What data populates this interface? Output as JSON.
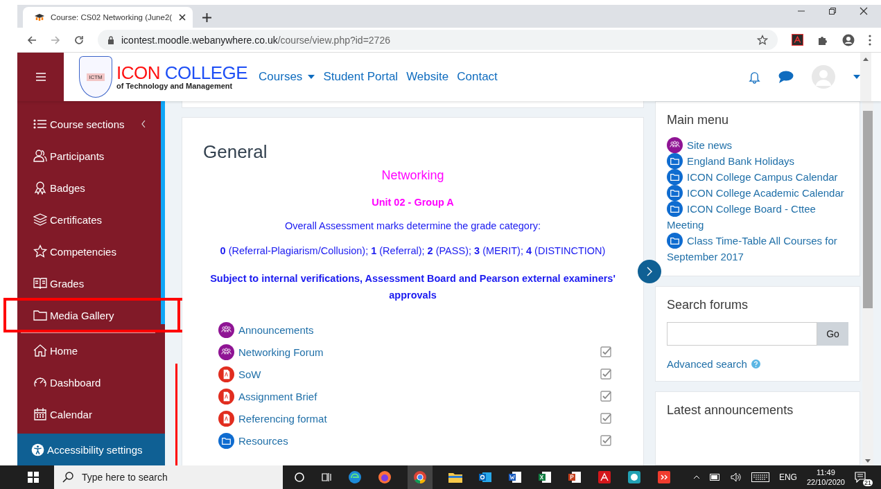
{
  "browser": {
    "tab_title": "Course: CS02 Networking (June2(",
    "url_host": "icontest.moodle.webanywhere.co.uk",
    "url_path": "/course/view.php?id=2726"
  },
  "header": {
    "brand_main": "ICON",
    "brand_second": "COLLEGE",
    "brand_sub": "of Technology and Management",
    "logo_caption": "ICTM",
    "nav": [
      {
        "label": "Courses",
        "dropdown": true
      },
      {
        "label": "Student Portal",
        "dropdown": false
      },
      {
        "label": "Website",
        "dropdown": false
      },
      {
        "label": "Contact",
        "dropdown": false
      }
    ]
  },
  "sidebar": {
    "items": [
      {
        "label": "Course sections",
        "collapsible": true
      },
      {
        "label": "Participants",
        "collapsible": false
      },
      {
        "label": "Badges",
        "collapsible": false
      },
      {
        "label": "Certificates",
        "collapsible": false
      },
      {
        "label": "Competencies",
        "collapsible": false
      },
      {
        "label": "Grades",
        "collapsible": false
      },
      {
        "label": "Media Gallery",
        "collapsible": false
      }
    ],
    "site_items": [
      {
        "label": "Home"
      },
      {
        "label": "Dashboard"
      },
      {
        "label": "Calendar"
      }
    ],
    "accessibility": "Accessibility settings"
  },
  "main": {
    "section_title": "General",
    "course_title": "Networking",
    "unit": "Unit 02 - Group A",
    "assessment_note": "Overall Assessment marks determine the grade category:",
    "grades_line": "**0** (Referral-Plagiarism/Collusion); **1** (Referral); **2** (PASS); **3** (MERIT); **4** (DISTINCTION)",
    "disclaimer": "Subject to internal verifications, Assessment Board and Pearson external examiners' approvals",
    "activities": [
      {
        "name": "Announcements",
        "kind": "forum"
      },
      {
        "name": "Networking Forum",
        "kind": "forum",
        "checked": true
      },
      {
        "name": "SoW",
        "kind": "pdf",
        "checked": true
      },
      {
        "name": "Assignment Brief",
        "kind": "pdf",
        "checked": true
      },
      {
        "name": "Referencing format",
        "kind": "pdf",
        "checked": true
      },
      {
        "name": "Resources",
        "kind": "folder",
        "checked": true
      }
    ]
  },
  "main_menu": {
    "title": "Main menu",
    "items": [
      {
        "name": "Site news",
        "kind": "forum"
      },
      {
        "name": "England Bank Holidays",
        "kind": "folder"
      },
      {
        "name": "ICON College Campus Calendar",
        "kind": "folder"
      },
      {
        "name": "ICON College Academic Calendar",
        "kind": "folder"
      },
      {
        "name": "ICON College Board - Cttee Meeting",
        "kind": "folder"
      },
      {
        "name": "Class Time-Table All Courses for September 2017",
        "kind": "folder"
      }
    ]
  },
  "search_forums": {
    "title": "Search forums",
    "button": "Go",
    "advanced": "Advanced search"
  },
  "latest": {
    "title": "Latest announcements"
  },
  "taskbar": {
    "search_placeholder": "Type here to search",
    "language": "ENG",
    "time": "11:49",
    "date": "22/10/2020",
    "notifications": "21"
  }
}
